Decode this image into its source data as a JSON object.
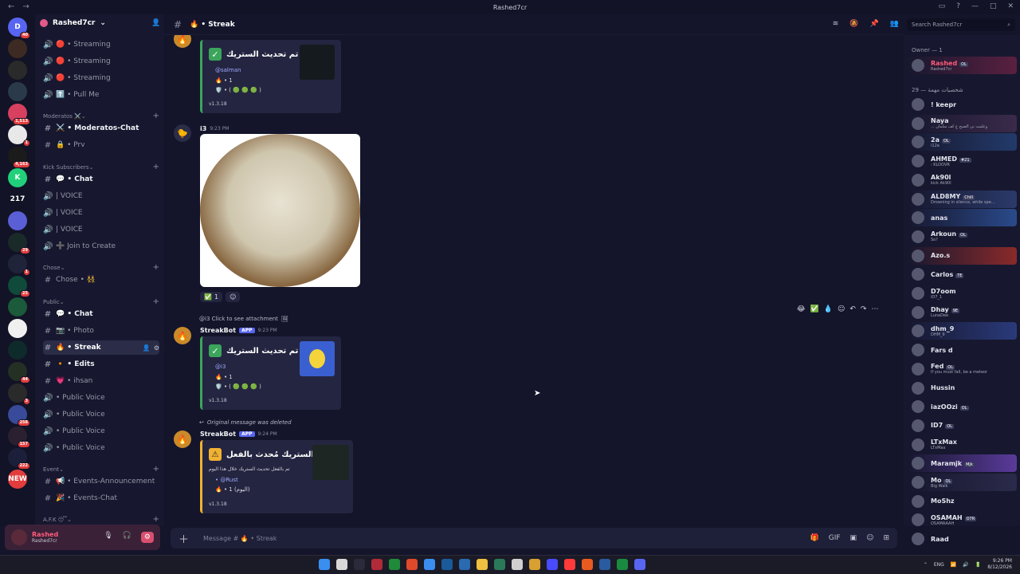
{
  "window": {
    "title": "Rashed7cr"
  },
  "servers": [
    {
      "label": "D",
      "color": "#5865f2",
      "badge": "40"
    },
    {
      "label": "",
      "color": "#3d2a22",
      "badge": ""
    },
    {
      "label": "",
      "color": "#2a2a2a",
      "badge": ""
    },
    {
      "label": "",
      "color": "#2b3a4a",
      "badge": ""
    },
    {
      "label": "",
      "color": "#d84060",
      "badge": "1,513"
    },
    {
      "label": "",
      "color": "#e8e8e8",
      "badge": "1"
    },
    {
      "label": "",
      "color": "#1b1b1b",
      "badge": "4,163"
    },
    {
      "label": "K",
      "color": "#21d07a",
      "badge": ""
    },
    {
      "label": "217",
      "color": "#121326",
      "badge": ""
    },
    {
      "label": "",
      "color": "#5a5fd6",
      "badge": ""
    },
    {
      "label": "",
      "color": "#1a2a28",
      "badge": "29"
    },
    {
      "label": "",
      "color": "#20243a",
      "badge": "1"
    },
    {
      "label": "",
      "color": "#0f4a3a",
      "badge": "25"
    },
    {
      "label": "",
      "color": "#1b5a3a",
      "badge": ""
    },
    {
      "label": "",
      "color": "#f0f0f0",
      "badge": ""
    },
    {
      "label": "",
      "color": "#0e2a2a",
      "badge": ""
    },
    {
      "label": "",
      "color": "#243024",
      "badge": "44"
    },
    {
      "label": "",
      "color": "#2a2a2a",
      "badge": "3"
    },
    {
      "label": "",
      "color": "#3a4a9a",
      "badge": "258"
    },
    {
      "label": "",
      "color": "#2a2030",
      "badge": "157"
    },
    {
      "label": "",
      "color": "#1b1f3a",
      "badge": "222"
    },
    {
      "label": "NEW",
      "color": "#e23c3c",
      "badge": ""
    }
  ],
  "guild": {
    "name": "Rashed7cr"
  },
  "channels": [
    {
      "icon": "🔊",
      "name": "🔴 • Streaming",
      "style": "",
      "top": 0
    },
    {
      "icon": "🔊",
      "name": "🔴 • Streaming",
      "style": ""
    },
    {
      "icon": "🔊",
      "name": "🔴 • Streaming",
      "style": ""
    },
    {
      "icon": "🔊",
      "name": "⬆️ • Pull Me",
      "style": ""
    }
  ],
  "categories": {
    "moderatos": "Moderatos ⚔️",
    "kick": "Kick Subscribers",
    "chose": "Chose",
    "public": "Public",
    "event": "Event",
    "afk": "A.F.K 😴"
  },
  "mod_channels": [
    {
      "icon": "#",
      "name": "⚔️ • Moderatos-Chat",
      "style": "bold"
    },
    {
      "icon": "#",
      "name": "🔒 • Prv",
      "style": ""
    }
  ],
  "kick_channels": [
    {
      "icon": "#",
      "name": "💬 • Chat",
      "style": "bold"
    },
    {
      "icon": "🔊",
      "name": "| VOICE",
      "style": ""
    },
    {
      "icon": "🔊",
      "name": "| VOICE",
      "style": ""
    },
    {
      "icon": "🔊",
      "name": "| VOICE",
      "style": ""
    },
    {
      "icon": "🔊",
      "name": "➕ Join to Create",
      "style": ""
    }
  ],
  "chose_channels": [
    {
      "icon": "#",
      "name": "Chose • 👯",
      "style": ""
    }
  ],
  "public_channels": [
    {
      "icon": "#",
      "name": "💬 • Chat",
      "style": "bold"
    },
    {
      "icon": "#",
      "name": "📷 • Photo",
      "style": ""
    },
    {
      "icon": "#",
      "name": "🔥 • Streak",
      "style": "sel"
    },
    {
      "icon": "#",
      "name": "🔸 • Edits",
      "style": "bold"
    },
    {
      "icon": "#",
      "name": "💗 • ihsan",
      "style": ""
    },
    {
      "icon": "🔊",
      "name": "• Public Voice",
      "style": ""
    },
    {
      "icon": "🔊",
      "name": "• Public Voice",
      "style": ""
    },
    {
      "icon": "🔊",
      "name": "• Public Voice",
      "style": ""
    },
    {
      "icon": "🔊",
      "name": "• Public Voice",
      "style": ""
    }
  ],
  "event_channels": [
    {
      "icon": "#",
      "name": "📢 • Events-Announcement",
      "style": ""
    },
    {
      "icon": "#",
      "name": "🎉 • Events-Chat",
      "style": ""
    }
  ],
  "user": {
    "name": "Rashed",
    "status": "Rashed7cr"
  },
  "header": {
    "channel": "🔥 • Streak"
  },
  "search": {
    "placeholder": "Search Rashed7cr"
  },
  "messages": {
    "m1": {
      "author": "StreakBot",
      "title": "تم تحديث الستريك •",
      "mention": "@salman",
      "streak": "🔥 • 1",
      "badges": "🛡️ • ( 🟢 🟢 🟢 )",
      "version": "v1.3.18"
    },
    "m2": {
      "author": "i3",
      "time": "9:23 PM",
      "reaction_count": "1"
    },
    "m3": {
      "reply": "@i3 Click to see attachment",
      "author": "StreakBot",
      "app": "APP",
      "time": "9:23 PM",
      "title": "تم تحديث الستريك •",
      "mention": "@i3",
      "streak": "🔥 • 1",
      "badges": "🛡️ • ( 🟢 🟢 🟢 )",
      "version": "v1.3.18"
    },
    "m4": {
      "reply": "Original message was deleted",
      "author": "StreakBot",
      "app": "APP",
      "time": "9:24 PM",
      "title": "الستريك مُحدث بالفعل",
      "desc": "تم بالفعل تحديث الستريك خلال هذا اليوم",
      "mention": "• @Rust",
      "streak": "🔥 • 1 (اليوم)",
      "version": "v1.3.18"
    }
  },
  "composer": {
    "placeholder": "Message # 🔥 • Streak"
  },
  "members": {
    "owner_header": "Owner — 1",
    "role_header": "شخصيات مهمة — 29",
    "list": [
      {
        "name": "Rashed",
        "tag": "OL",
        "status": "Rashed7cr",
        "color": "#ff5c7a",
        "bg": "#5a2040"
      },
      {
        "name": "! keepr",
        "tag": "",
        "status": "",
        "color": "#e3e5ee",
        "bg": ""
      },
      {
        "name": "Naya",
        "tag": "",
        "status": "... وعلمت بي الصبح ع كف سلمان",
        "color": "#e3e5ee",
        "bg": "#3a2a4a"
      },
      {
        "name": "2a",
        "tag": "OL",
        "status": "i12a",
        "color": "#e3e5ee",
        "bg": "#233a6a"
      },
      {
        "name": "AHMED",
        "tag": "#21",
        "status": ": KLOOVR",
        "color": "#e3e5ee",
        "bg": ""
      },
      {
        "name": "Ak90l",
        "tag": "",
        "status": "kick Ak90l",
        "color": "#e3e5ee",
        "bg": ""
      },
      {
        "name": "ALD8MY",
        "tag": "Chill",
        "status": "Drowning in silence, while spe...",
        "color": "#e3e5ee",
        "bg": "#2a3a6a"
      },
      {
        "name": "anas",
        "tag": "",
        "status": "",
        "color": "#e3e5ee",
        "bg": "#2a4a8a"
      },
      {
        "name": "Arkoun",
        "tag": "OL",
        "status": "So?",
        "color": "#e3e5ee",
        "bg": ""
      },
      {
        "name": "Azo.s",
        "tag": "",
        "status": "",
        "color": "#e3e5ee",
        "bg": "#8a2a2a"
      },
      {
        "name": "Carlos",
        "tag": "TE",
        "status": "",
        "color": "#e3e5ee",
        "bg": ""
      },
      {
        "name": "D7oom",
        "tag": "",
        "status": "iD7_1",
        "color": "#e3e5ee",
        "bg": ""
      },
      {
        "name": "Dhay",
        "tag": "9E",
        "status": "LunaDee",
        "color": "#e3e5ee",
        "bg": ""
      },
      {
        "name": "dhm_9",
        "tag": "",
        "status": "DHM_9",
        "color": "#e3e5ee",
        "bg": "#2a3a7a"
      },
      {
        "name": "Fars d",
        "tag": "",
        "status": "",
        "color": "#e3e5ee",
        "bg": ""
      },
      {
        "name": "Fed",
        "tag": "OL",
        "status": "If you must fall, be a meteor",
        "color": "#e3e5ee",
        "bg": ""
      },
      {
        "name": "Hussin",
        "tag": "",
        "status": "",
        "color": "#e3e5ee",
        "bg": ""
      },
      {
        "name": "iazOOzi",
        "tag": "OL",
        "status": "",
        "color": "#e3e5ee",
        "bg": ""
      },
      {
        "name": "ID7",
        "tag": "OL",
        "status": "",
        "color": "#e3e5ee",
        "bg": ""
      },
      {
        "name": "LTxMax",
        "tag": "",
        "status": "LTxMax",
        "color": "#e3e5ee",
        "bg": ""
      },
      {
        "name": "Maramjk",
        "tag": "Mjk",
        "status": "",
        "color": "#e3e5ee",
        "bg": "#5a3a9a"
      },
      {
        "name": "Mo",
        "tag": "OL",
        "status": "Big Walk",
        "color": "#e3e5ee",
        "bg": "#2a2a4a"
      },
      {
        "name": "MoShz",
        "tag": "",
        "status": "",
        "color": "#e3e5ee",
        "bg": ""
      },
      {
        "name": "OSAMAH",
        "tag": "O7R",
        "status": "OSAMAAAH",
        "color": "#e3e5ee",
        "bg": ""
      },
      {
        "name": "Raad",
        "tag": "",
        "status": "",
        "color": "#e3e5ee",
        "bg": ""
      }
    ]
  },
  "tray": {
    "lang": "ENG",
    "time": "9:26 PM",
    "date": "8/12/2026"
  },
  "taskbar_colors": [
    "#3a8ef0",
    "#d8d8d8",
    "#2a2a3a",
    "#b02a3a",
    "#1f8a3a",
    "#e04a2a",
    "#3a8ef0",
    "#1a5a9a",
    "#2a6ab0",
    "#f0c040",
    "#2a7a5a",
    "#d0d0d0",
    "#d8a030",
    "#4a4aff",
    "#ff3a3a",
    "#e85a20",
    "#2a5aa0",
    "#1a8a40",
    "#5865f2"
  ]
}
